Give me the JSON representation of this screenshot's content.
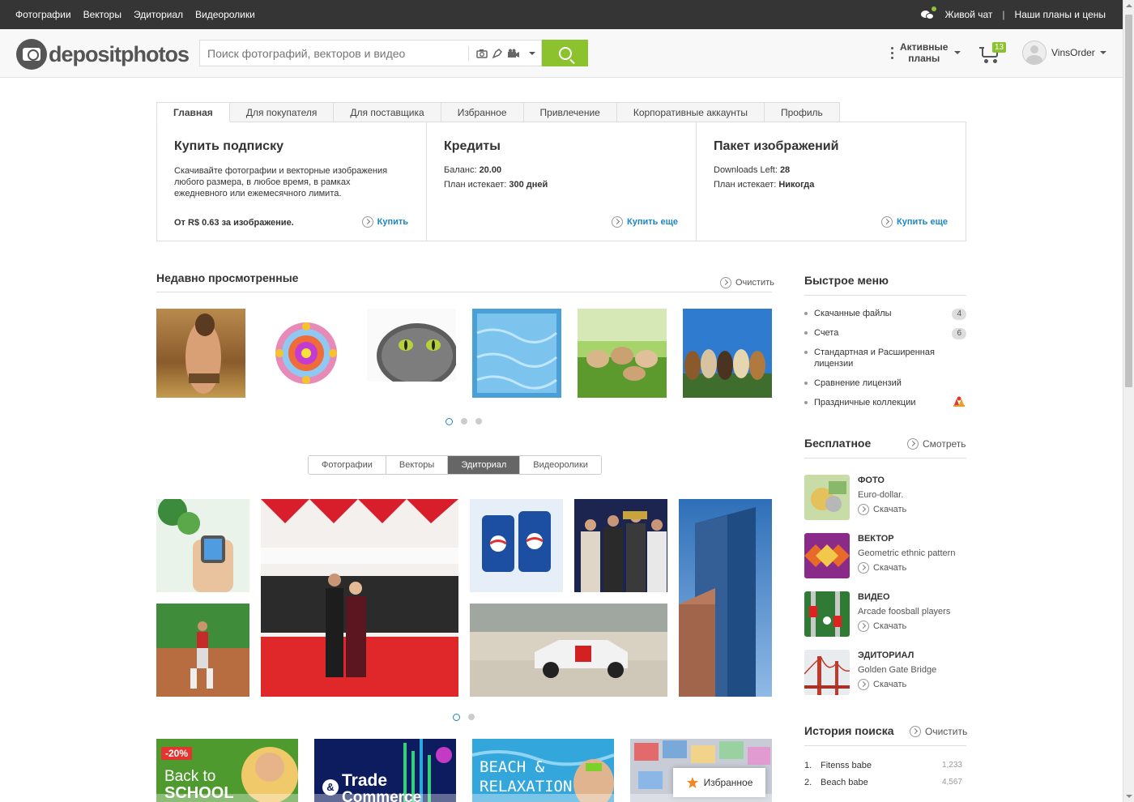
{
  "topbar": {
    "nav": [
      "Фотографии",
      "Векторы",
      "Эдиториал",
      "Видеоролики"
    ],
    "live_chat": "Живой чат",
    "plans": "Наши планы и цены"
  },
  "header": {
    "logo_text": "depositphotos",
    "search_placeholder": "Поиск фотографий, векторов и видео",
    "active_plans_line1": "Активные",
    "active_plans_line2": "планы",
    "cart_count": "13",
    "username": "VinsOrder",
    "accent_color": "#8cc22e"
  },
  "tabs": [
    "Главная",
    "Для покупателя",
    "Для поставщика",
    "Избранное",
    "Привлечение",
    "Корпоративные аккаунты",
    "Профиль"
  ],
  "panel": {
    "subscription": {
      "title": "Купить подписку",
      "desc": "Скачивайте фотографии и векторные изображения любого размера, в любое время, в рамках ежедневного или ежемесячного лимита.",
      "price": "От R$ 0.63 за изображение.",
      "action": "Купить"
    },
    "credits": {
      "title": "Кредиты",
      "balance_label": "Баланс: ",
      "balance_value": "20.00",
      "expires_label": "План истекает: ",
      "expires_value": "300 дней",
      "action": "Купить еще"
    },
    "pack": {
      "title": "Пакет изображений",
      "left_label": "Downloads Left: ",
      "left_value": "28",
      "expires_label": "План истекает: ",
      "expires_value": "Никогда",
      "action": "Купить еще"
    }
  },
  "recent": {
    "title": "Недавно просмотренные",
    "clear": "Очистить"
  },
  "media_filter": {
    "options": [
      "Фотографии",
      "Векторы",
      "Эдиториал",
      "Видеоролики"
    ],
    "selected": "Эдиториал"
  },
  "quick_menu": {
    "title": "Быстрое меню",
    "items": [
      {
        "label": "Скачанные файлы",
        "count": "4"
      },
      {
        "label": "Счета",
        "count": "6"
      },
      {
        "label": "Стандартная и Расширенная лицензии",
        "count": ""
      },
      {
        "label": "Сравнение лицензий",
        "count": ""
      },
      {
        "label": "Праздничные коллекции",
        "count": ""
      }
    ]
  },
  "free": {
    "title": "Бесплатное",
    "view": "Смотреть",
    "download": "Скачать",
    "items": [
      {
        "type": "ФОТО",
        "name": "Euro-dollar."
      },
      {
        "type": "ВЕКТОР",
        "name": "Geometric ethnic pattern"
      },
      {
        "type": "ВИДЕО",
        "name": "Arcade foosball players"
      },
      {
        "type": "ЭДИТОРИАЛ",
        "name": "Golden Gate Bridge"
      }
    ]
  },
  "history": {
    "title": "История поиска",
    "clear": "Очистить",
    "items": [
      {
        "n": "1.",
        "q": "Fitenss babe",
        "c": "1,233"
      },
      {
        "n": "2.",
        "q": "Beach babe",
        "c": "4,567"
      }
    ]
  },
  "banners": {
    "b1_badge": "-20%",
    "b1_text1": "Back to",
    "b1_text2": "SCHOOL",
    "b2_text1": "Trade",
    "b2_text2": "Commerce",
    "b3_text1": "BEACH &",
    "b3_text2": "RELAXATION"
  },
  "favorites_button": "Избранное"
}
